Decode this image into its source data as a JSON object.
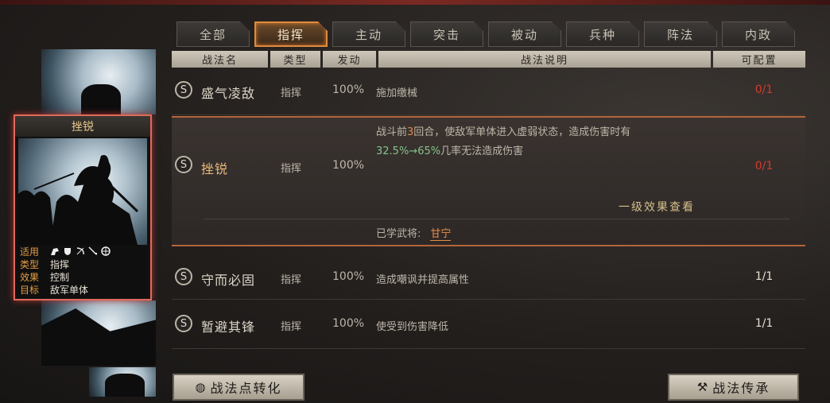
{
  "tabs": [
    "全部",
    "指挥",
    "主动",
    "突击",
    "被动",
    "兵种",
    "阵法",
    "内政"
  ],
  "active_tab_index": 1,
  "headers": {
    "name": "战法名",
    "type": "类型",
    "trigger": "发动",
    "desc": "战法说明",
    "config": "可配置"
  },
  "rows": [
    {
      "badge": "S",
      "name": "盛气凌敌",
      "type": "指挥",
      "rate": "100%",
      "desc": "施加缴械",
      "config": "0/1"
    },
    {
      "badge": "S",
      "name": "挫锐",
      "type": "指挥",
      "rate": "100%",
      "desc_line1_a": "战斗前",
      "desc_line1_num": "3",
      "desc_line1_b": "回合，使敌军单体进入虚弱状态，造成伤害时有",
      "desc_line2_a": "32.5%→65%",
      "desc_line2_b": "几率无法造成伤害",
      "more": "一级效果查看",
      "learned_label": "已学武将:",
      "learned_general": "甘宁",
      "config": "0/1"
    },
    {
      "badge": "S",
      "name": "守而必固",
      "type": "指挥",
      "rate": "100%",
      "desc": "造成嘲讽并提高属性",
      "config": "1/1"
    },
    {
      "badge": "S",
      "name": "暂避其锋",
      "type": "指挥",
      "rate": "100%",
      "desc": "使受到伤害降低",
      "config": "1/1"
    }
  ],
  "card": {
    "title": "挫锐",
    "labels": {
      "applicable": "适用",
      "type": "类型",
      "effect": "效果",
      "target": "目标"
    },
    "type": "指挥",
    "effect": "控制",
    "target": "敌军单体",
    "troop_icons": [
      "cavalry-icon",
      "shield-icon",
      "bow-icon",
      "spear-icon",
      "wheel-icon"
    ]
  },
  "buttons": {
    "convert": "战法点转化",
    "inherit": "战法传承"
  },
  "colors": {
    "accent": "#e08a3c",
    "red": "#d43a2a",
    "green": "#86c28a",
    "label_orange": "#e39c44"
  }
}
